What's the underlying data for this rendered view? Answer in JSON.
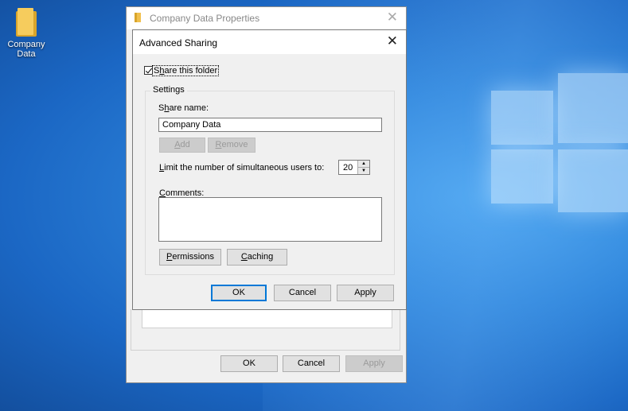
{
  "desktop": {
    "icon_label_line1": "Company",
    "icon_label_line2": "Data"
  },
  "properties_window": {
    "title": "Company Data Properties",
    "close_glyph": "✕",
    "ok_label": "OK",
    "cancel_label": "Cancel",
    "apply_label": "Apply"
  },
  "advanced_sharing": {
    "title": "Advanced Sharing",
    "close_glyph": "✕",
    "share_checkbox": {
      "checked": true,
      "label_pre": "S",
      "label_underlined": "h",
      "label_post": "are this folder"
    },
    "settings_group_label": "Settings",
    "share_name": {
      "label_pre": "S",
      "label_underlined": "h",
      "label_post": "are name:",
      "value": "Company Data"
    },
    "add_button": {
      "label_underlined": "A",
      "label_post": "dd"
    },
    "remove_button": {
      "label_underlined": "R",
      "label_post": "emove"
    },
    "limit": {
      "label_underlined": "L",
      "label_post": "imit the number of simultaneous users to:",
      "value": "20"
    },
    "comments": {
      "label_underlined": "C",
      "label_post": "omments:",
      "value": ""
    },
    "permissions_button": {
      "label_underlined": "P",
      "label_post": "ermissions"
    },
    "caching_button": {
      "label_underlined": "C",
      "label_post": "aching"
    },
    "ok_label": "OK",
    "cancel_label": "Cancel",
    "apply_label": "Apply"
  },
  "colors": {
    "desktop_blue": "#1b67c4",
    "focus_blue": "#0078d7",
    "folder_yellow": "#f6cc5d"
  },
  "icons": [
    "folder-icon",
    "close-icon",
    "checkbox-checked-icon",
    "spin-up-icon",
    "spin-down-icon"
  ]
}
